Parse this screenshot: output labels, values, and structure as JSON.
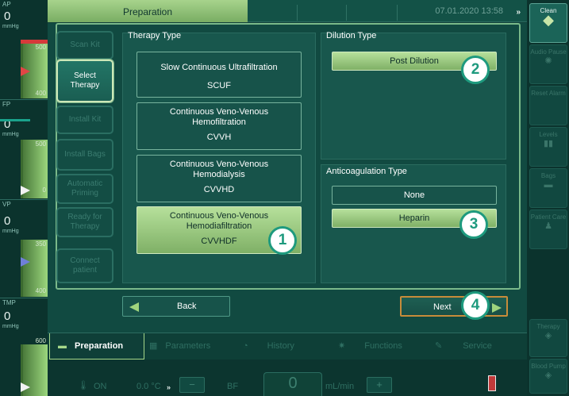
{
  "app": {
    "title": "Preparation",
    "datetime": "07.01.2020 13:58",
    "datetime_chevron": "»"
  },
  "left_gauges": [
    {
      "label": "AP",
      "value": "0",
      "unit": "mmHg",
      "tick_top": "500",
      "tick_bottom": "400"
    },
    {
      "label": "FP",
      "value": "0",
      "unit": "mmHg",
      "tick_top": "500",
      "tick_bottom": "0"
    },
    {
      "label": "VP",
      "value": "0",
      "unit": "mmHg",
      "tick_top": "350",
      "tick_bottom": "400"
    },
    {
      "label": "TMP",
      "value": "0",
      "unit": "mmHg",
      "tick_top": "600",
      "tick_bottom": ""
    }
  ],
  "steps": [
    {
      "label": "Scan Kit"
    },
    {
      "label": "Select Therapy"
    },
    {
      "label": "Install Kit"
    },
    {
      "label": "Install Bags"
    },
    {
      "label": "Automatic Priming"
    },
    {
      "label": "Ready for Therapy"
    },
    {
      "label": "Connect patient"
    }
  ],
  "therapy": {
    "title": "Therapy Type",
    "options": [
      {
        "name": "Slow Continuous Ultrafiltration",
        "abbr": "SCUF"
      },
      {
        "name": "Continuous Veno-Venous Hemofiltration",
        "abbr": "CVVH"
      },
      {
        "name": "Continuous Veno-Venous Hemodialysis",
        "abbr": "CVVHD"
      },
      {
        "name": "Continuous Veno-Venous Hemodiafiltration",
        "abbr": "CVVHDF"
      }
    ]
  },
  "dilution": {
    "title": "Dilution Type",
    "options": [
      {
        "name": "Post Dilution"
      }
    ]
  },
  "anticoag": {
    "title": "Anticoagulation Type",
    "options": [
      {
        "name": "None"
      },
      {
        "name": "Heparin"
      }
    ]
  },
  "badges": [
    "1",
    "2",
    "3",
    "4"
  ],
  "nav": {
    "back": "Back",
    "next": "Next"
  },
  "tabs": [
    {
      "label": "Preparation"
    },
    {
      "label": "Parameters"
    },
    {
      "label": "History"
    },
    {
      "label": "Functions"
    },
    {
      "label": "Service"
    }
  ],
  "right_buttons": [
    {
      "label": "Clean"
    },
    {
      "label": "Audio Pause"
    },
    {
      "label": "Reset Alarm"
    },
    {
      "label": "Levels"
    },
    {
      "label": "Bags"
    },
    {
      "label": "Patient Care"
    },
    {
      "label": "Therapy"
    },
    {
      "label": "Blood Pump"
    }
  ],
  "status": {
    "heater_state": "ON",
    "temp": "0.0 °C",
    "temp_chevron": "»",
    "minus": "−",
    "plus": "+",
    "bf_label": "BF",
    "bf_value": "0",
    "bf_unit": "mL/min"
  },
  "colors": {
    "background": "#0f3f38",
    "selected_option": "#9fce84",
    "badge_accent": "#1e9a7e",
    "next_border": "#c88c3a"
  }
}
